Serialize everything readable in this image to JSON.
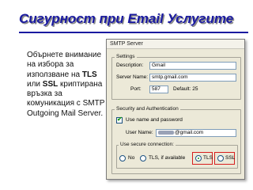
{
  "slide": {
    "title": "Сигурност при Email Услугите",
    "body_part1": "Обърнете внимание на избора за използване на ",
    "tls": "TLS",
    "or": " или ",
    "ssl": "SSL",
    "body_part2": " криптирана връзка за комуникация с SMTP Outgoing Mail Server."
  },
  "dialog": {
    "title": "SMTP Server",
    "settings_group": "Settings",
    "description_label": "Description:",
    "description_value": "Gmail",
    "server_name_label": "Server Name:",
    "server_name_value": "smtp.gmail.com",
    "port_label": "Port:",
    "port_value": "587",
    "default_label": "Default: 25",
    "security_group": "Security and Authentication",
    "use_name_password_label": "Use name and password",
    "use_name_password_checked": true,
    "user_name_label": "User Name:",
    "user_name_value": "@gmail.com",
    "secure_connection_group": "Use secure connection:",
    "radio_options": [
      {
        "label": "No",
        "selected": false
      },
      {
        "label": "TLS, if available",
        "selected": false
      },
      {
        "label": "TLS",
        "selected": true
      },
      {
        "label": "SSL",
        "selected": false
      }
    ]
  },
  "colors": {
    "title": "#1a1aa0",
    "highlight": "#d61e1e",
    "selected_radio": "#1b9a1b"
  }
}
